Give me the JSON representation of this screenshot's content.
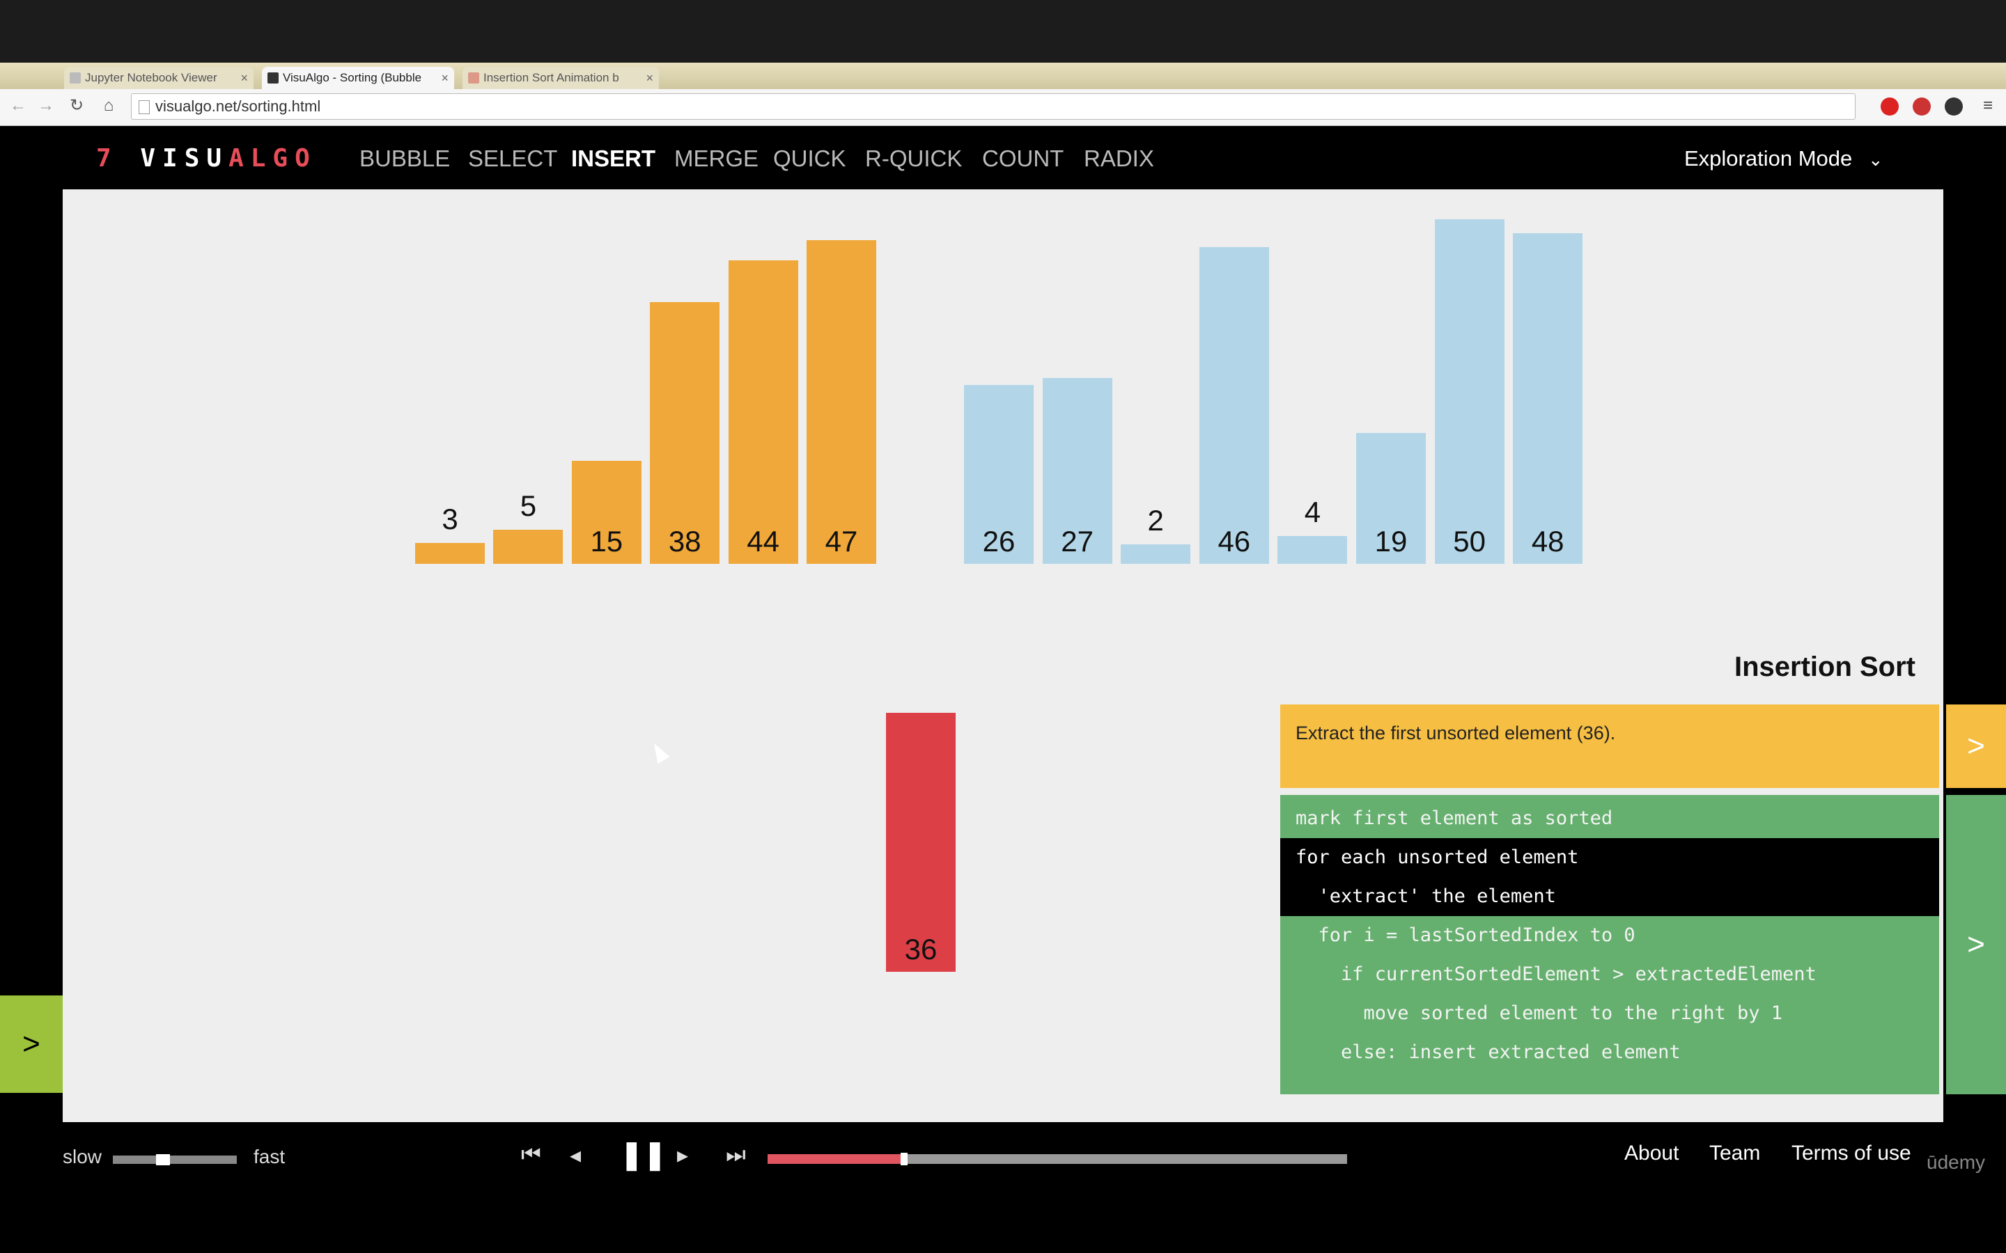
{
  "browser": {
    "tabs": [
      {
        "label": "Jupyter Notebook Viewer",
        "active": false
      },
      {
        "label": "VisuAlgo - Sorting (Bubble",
        "active": true
      },
      {
        "label": "Insertion Sort Animation b",
        "active": false
      }
    ],
    "url": "visualgo.net/sorting.html"
  },
  "header": {
    "logo_num": "7",
    "logo_text_a": "VISU",
    "logo_text_b": "ALGO",
    "nav": [
      "BUBBLE",
      "SELECT",
      "INSERT",
      "MERGE",
      "QUICK",
      "R-QUICK",
      "COUNT",
      "RADIX"
    ],
    "active_nav": "INSERT",
    "mode": "Exploration Mode"
  },
  "array": {
    "sorted": [
      3,
      5,
      15,
      38,
      44,
      47
    ],
    "unsorted": [
      26,
      27,
      2,
      46,
      4,
      19,
      50,
      48
    ],
    "extracted": 36,
    "colors": {
      "sorted": "#f0a83a",
      "unsorted": "#b2d6e8",
      "extracted": "#dd3f47"
    }
  },
  "panel": {
    "title": "Insertion Sort",
    "status": "Extract the first unsorted element (36).",
    "code": [
      "mark first element as sorted",
      "for each unsorted element",
      "  'extract' the element",
      "  for i = lastSortedIndex to 0",
      "    if currentSortedElement > extractedElement",
      "      move sorted element to the right by 1",
      "    else: insert extracted element"
    ],
    "highlighted_lines": [
      1,
      2
    ]
  },
  "controls": {
    "slow": "slow",
    "fast": "fast",
    "speed": 0.35,
    "progress": 0.23
  },
  "footer": {
    "links": [
      "About",
      "Team",
      "Terms of use"
    ],
    "brand": "ūdemy"
  }
}
